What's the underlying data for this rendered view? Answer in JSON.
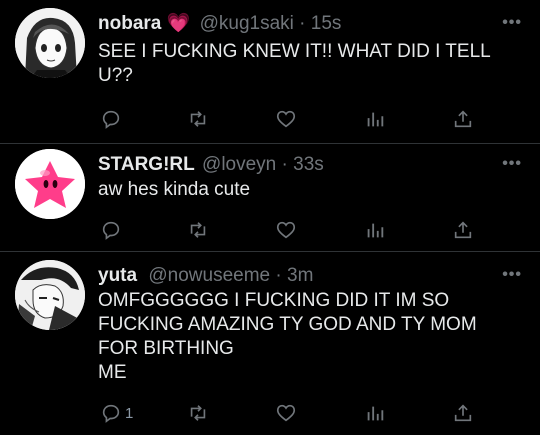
{
  "tweets": [
    {
      "name": "nobara",
      "emoji": "💗",
      "handle": "@kug1saki",
      "sep": "·",
      "time": "15s",
      "text": "SEE I FUCKING KNEW IT!! WHAT DID I TELL U??",
      "reply_count": ""
    },
    {
      "name": "STARG!RL",
      "emoji": "",
      "handle": "@loveyn",
      "sep": "·",
      "time": "33s",
      "text": "aw hes kinda cute",
      "reply_count": ""
    },
    {
      "name": "yuta",
      "emoji": "",
      "handle": "@nowuseeme",
      "sep": "·",
      "time": "3m",
      "text": "OMFGGGGGG I FUCKING DID IT IM SO FUCKING AMAZING TY GOD AND TY MOM FOR BIRTHING\nME",
      "reply_count": "1"
    }
  ],
  "more_label": "•••",
  "colors": {
    "background": "#000000",
    "text": "#e7e9ea",
    "muted": "#71767b",
    "heart_emoji": "#ff4fa0",
    "avatar_star": "#ff3d8a"
  },
  "icons": [
    "reply-icon",
    "retweet-icon",
    "like-icon",
    "analytics-icon",
    "share-icon"
  ]
}
